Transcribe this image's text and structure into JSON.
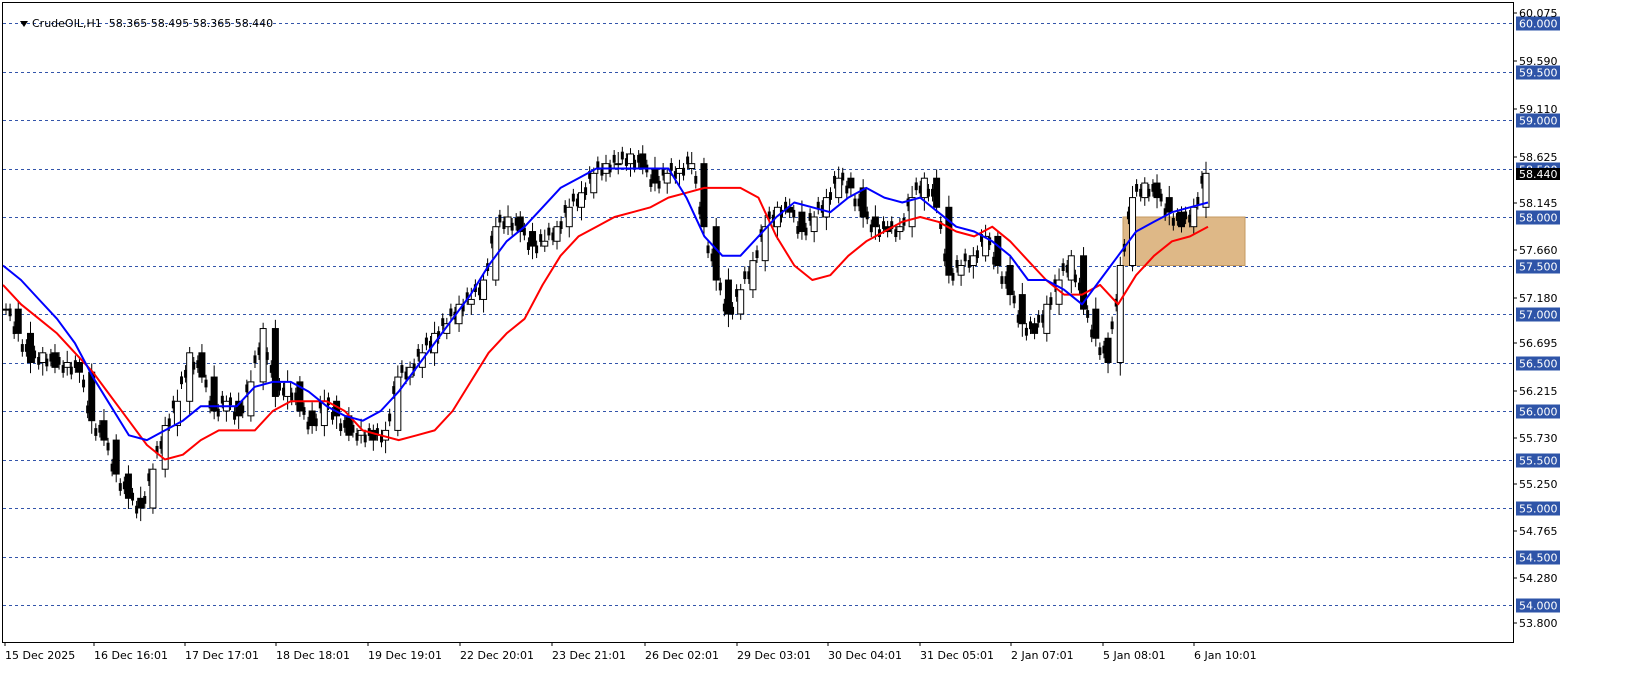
{
  "header": {
    "symbol": "CrudeOIL,H1",
    "ohlc": "58.365 58.495 58.365 58.440"
  },
  "colors": {
    "background": "#ffffff",
    "candle": "#000000",
    "ma_fast": "#ff0000",
    "ma_slow": "#0000ff",
    "level_line": "#3355aa",
    "level_label_bg": "#2e54a8",
    "zone_fill": "#deb887",
    "price_tag_bg": "#000000"
  },
  "chart_data": {
    "type": "candlestick",
    "title": "",
    "grid": false,
    "ylim": [
      53.6,
      60.1
    ],
    "y_ticks": [
      "60.075",
      "59.590",
      "59.110",
      "58.625",
      "58.145",
      "57.660",
      "57.180",
      "56.695",
      "56.215",
      "55.730",
      "55.250",
      "54.765",
      "54.280",
      "53.800"
    ],
    "x_ticks": [
      "15 Dec 2025",
      "16 Dec 16:01",
      "17 Dec 17:01",
      "18 Dec 18:01",
      "19 Dec 19:01",
      "22 Dec 20:01",
      "23 Dec 21:01",
      "26 Dec 02:01",
      "29 Dec 03:01",
      "30 Dec 04:01",
      "31 Dec 05:01",
      "2 Jan 07:01",
      "5 Jan 08:01",
      "6 Jan 10:01"
    ],
    "horizontal_levels": [
      "60.000",
      "59.500",
      "59.000",
      "58.500",
      "58.000",
      "57.500",
      "57.000",
      "56.500",
      "56.000",
      "55.500",
      "55.000",
      "54.500",
      "54.000"
    ],
    "current_price": "58.440",
    "zone": {
      "from_price": 57.5,
      "to_price": 58.0,
      "from_tick": "5 Jan 08:01"
    },
    "series": [
      {
        "type": "line",
        "color": "#ff0000",
        "values": [
          57.3,
          57.1,
          56.95,
          56.8,
          56.6,
          56.4,
          56.15,
          55.9,
          55.65,
          55.5,
          55.55,
          55.7,
          55.8,
          55.8,
          55.8,
          56.0,
          56.1,
          56.1,
          56.1,
          56.0,
          55.8,
          55.75,
          55.7,
          55.75,
          55.8,
          56.0,
          56.3,
          56.6,
          56.8,
          56.95,
          57.3,
          57.6,
          57.8,
          57.9,
          58.0,
          58.05,
          58.1,
          58.2,
          58.25,
          58.3,
          58.3,
          58.3,
          58.2,
          57.8,
          57.5,
          57.35,
          57.4,
          57.6,
          57.75,
          57.85,
          57.95,
          58.0,
          57.95,
          57.85,
          57.8,
          57.9,
          57.75,
          57.55,
          57.35,
          57.2,
          57.2,
          57.3,
          57.1,
          57.4,
          57.6,
          57.75,
          57.8,
          57.9
        ]
      },
      {
        "type": "line",
        "color": "#0000ff",
        "values": [
          57.5,
          57.35,
          57.15,
          56.95,
          56.7,
          56.35,
          56.05,
          55.75,
          55.7,
          55.8,
          55.9,
          56.05,
          56.05,
          56.05,
          56.25,
          56.3,
          56.3,
          56.2,
          56.05,
          55.95,
          55.9,
          56.0,
          56.2,
          56.45,
          56.7,
          56.95,
          57.2,
          57.5,
          57.75,
          57.9,
          58.1,
          58.3,
          58.4,
          58.5,
          58.5,
          58.5,
          58.5,
          58.5,
          58.2,
          57.8,
          57.6,
          57.6,
          57.8,
          58.0,
          58.15,
          58.1,
          58.05,
          58.2,
          58.3,
          58.2,
          58.15,
          58.2,
          58.05,
          57.9,
          57.85,
          57.75,
          57.6,
          57.35,
          57.35,
          57.25,
          57.1,
          57.35,
          57.6,
          57.85,
          57.95,
          58.05,
          58.1,
          58.15
        ]
      }
    ],
    "candles_close": [
      57.05,
      56.8,
      56.5,
      56.6,
      56.45,
      56.5,
      56.4,
      55.9,
      55.7,
      55.35,
      55.1,
      55.0,
      55.4,
      55.85,
      56.1,
      56.6,
      56.35,
      56.0,
      56.1,
      55.95,
      56.3,
      56.85,
      56.15,
      56.3,
      56.0,
      55.85,
      56.1,
      55.95,
      55.75,
      55.8,
      55.7,
      55.8,
      56.35,
      56.45,
      56.6,
      56.8,
      56.9,
      57.1,
      57.15,
      57.35,
      57.9,
      58.0,
      57.85,
      57.7,
      57.75,
      57.9,
      58.1,
      58.25,
      58.45,
      58.55,
      58.55,
      58.65,
      58.5,
      58.35,
      58.45,
      58.5,
      58.55,
      57.9,
      57.35,
      57.0,
      57.25,
      57.55,
      57.9,
      58.1,
      58.05,
      57.85,
      58.0,
      58.2,
      58.4,
      58.3,
      58.0,
      57.9,
      57.85,
      57.9,
      58.2,
      58.4,
      58.1,
      57.4,
      57.5,
      57.6,
      57.8,
      57.5,
      57.2,
      56.9,
      56.8,
      57.1,
      57.35,
      57.6,
      57.05,
      56.75,
      56.5,
      57.5,
      58.2,
      58.35,
      58.2,
      58.05,
      57.9,
      58.1,
      58.45
    ]
  }
}
